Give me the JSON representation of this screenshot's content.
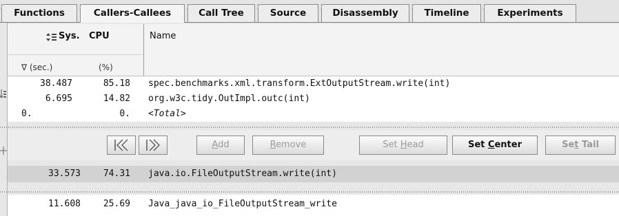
{
  "tabs": [
    {
      "label": "Functions"
    },
    {
      "label": "Callers-Callees",
      "active": true
    },
    {
      "label": "Call Tree"
    },
    {
      "label": "Source"
    },
    {
      "label": "Disassembly"
    },
    {
      "label": "Timeline"
    },
    {
      "label": "Experiments"
    }
  ],
  "header": {
    "metric_title": "Sys.",
    "metric_name": "CPU",
    "name_col": "Name",
    "unit_sec": "∇ (sec.)",
    "unit_pct": "(%)"
  },
  "callers": [
    {
      "sec": "38.487",
      "pct": "85.18",
      "name": "spec.benchmarks.xml.transform.ExtOutputStream.write(int)"
    },
    {
      "sec": "6.695",
      "pct": "14.82",
      "name": "org.w3c.tidy.OutImpl.outc(int)"
    },
    {
      "sec": "0.",
      "pct": "0.",
      "name": "<Total>"
    }
  ],
  "buttons": {
    "back": "back-arrow",
    "forward": "forward-arrow",
    "add_pre": "",
    "add_key": "A",
    "add_post": "dd",
    "remove_pre": "",
    "remove_key": "R",
    "remove_post": "emove",
    "head_pre": "Set ",
    "head_key": "H",
    "head_post": "ead",
    "center_pre": "Set ",
    "center_key": "C",
    "center_post": "enter",
    "tail_pre": "Se",
    "tail_key": "t",
    "tail_post": " Tail"
  },
  "center": {
    "sec": "33.573",
    "pct": "74.31",
    "name": "java.io.FileOutputStream.write(int)"
  },
  "callees": [
    {
      "sec": "11.608",
      "pct": "25.69",
      "name": "Java_java_io_FileOutputStream_write"
    }
  ],
  "colors": {
    "selected_row": "#d2d2d2",
    "panel": "#ffffff",
    "chrome": "#e4e4e4"
  }
}
